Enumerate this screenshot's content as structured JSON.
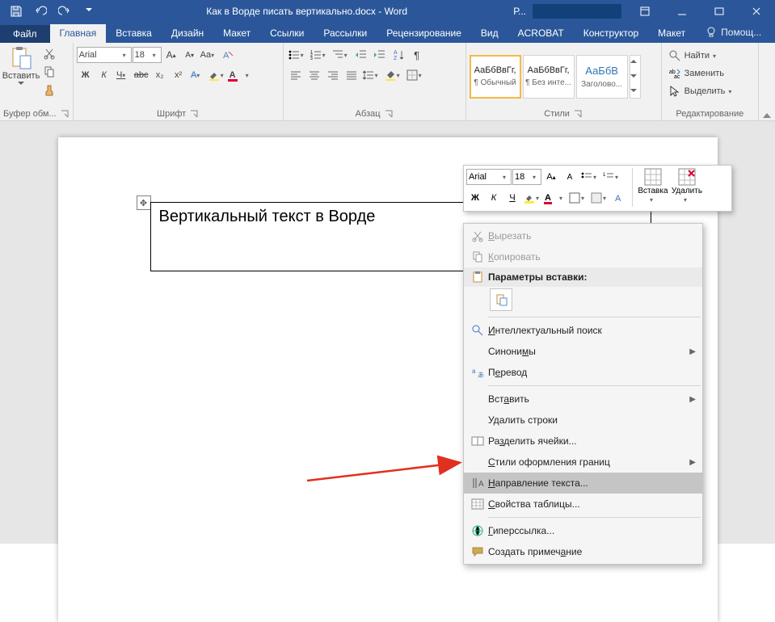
{
  "titlebar": {
    "doc_title": "Как в Ворде писать вертикально.docx - Word",
    "account_initial": "Р..."
  },
  "tabs": {
    "file": "Файл",
    "home": "Главная",
    "insert": "Вставка",
    "design": "Дизайн",
    "layout": "Макет",
    "references": "Ссылки",
    "mailings": "Рассылки",
    "review": "Рецензирование",
    "view": "Вид",
    "acrobat": "ACROBAT",
    "constructor": "Конструктор",
    "layout2": "Макет",
    "tell_me": "Помощ..."
  },
  "ribbon": {
    "clipboard": {
      "paste": "Вставить",
      "group": "Буфер обм..."
    },
    "font": {
      "name": "Arial",
      "size": "18",
      "bold": "Ж",
      "italic": "К",
      "underline": "Ч",
      "strike": "abc",
      "sub": "x₂",
      "sup": "x²",
      "effects": "A",
      "case": "Aa",
      "group": "Шрифт"
    },
    "paragraph": {
      "group": "Абзац"
    },
    "styles": {
      "preview": "АаБбВвГг,",
      "preview_heading": "АаБбВ",
      "normal": "¶ Обычный",
      "nospace": "¶ Без инте...",
      "heading1": "Заголово...",
      "group": "Стили"
    },
    "editing": {
      "find": "Найти",
      "replace": "Заменить",
      "select": "Выделить",
      "group": "Редактирование"
    }
  },
  "minibar": {
    "font": "Arial",
    "size": "18",
    "bold": "Ж",
    "italic": "К",
    "underline": "Ч",
    "insert": "Вставка",
    "delete": "Удалить"
  },
  "document": {
    "cell_text": "Вертикальный текст в Ворде"
  },
  "context": {
    "cut": "Вырезать",
    "copy": "Копировать",
    "paste_header": "Параметры вставки:",
    "smart_lookup": "Интеллектуальный поиск",
    "synonyms": "Синонимы",
    "translate": "Перевод",
    "insert": "Вставить",
    "delete_rows": "Удалить строки",
    "split_cells": "Разделить ячейки...",
    "border_styles": "Стили оформления границ",
    "text_direction": "Направление текста...",
    "table_props": "Свойства таблицы...",
    "hyperlink": "Гиперссылка...",
    "new_comment": "Создать примечание"
  }
}
